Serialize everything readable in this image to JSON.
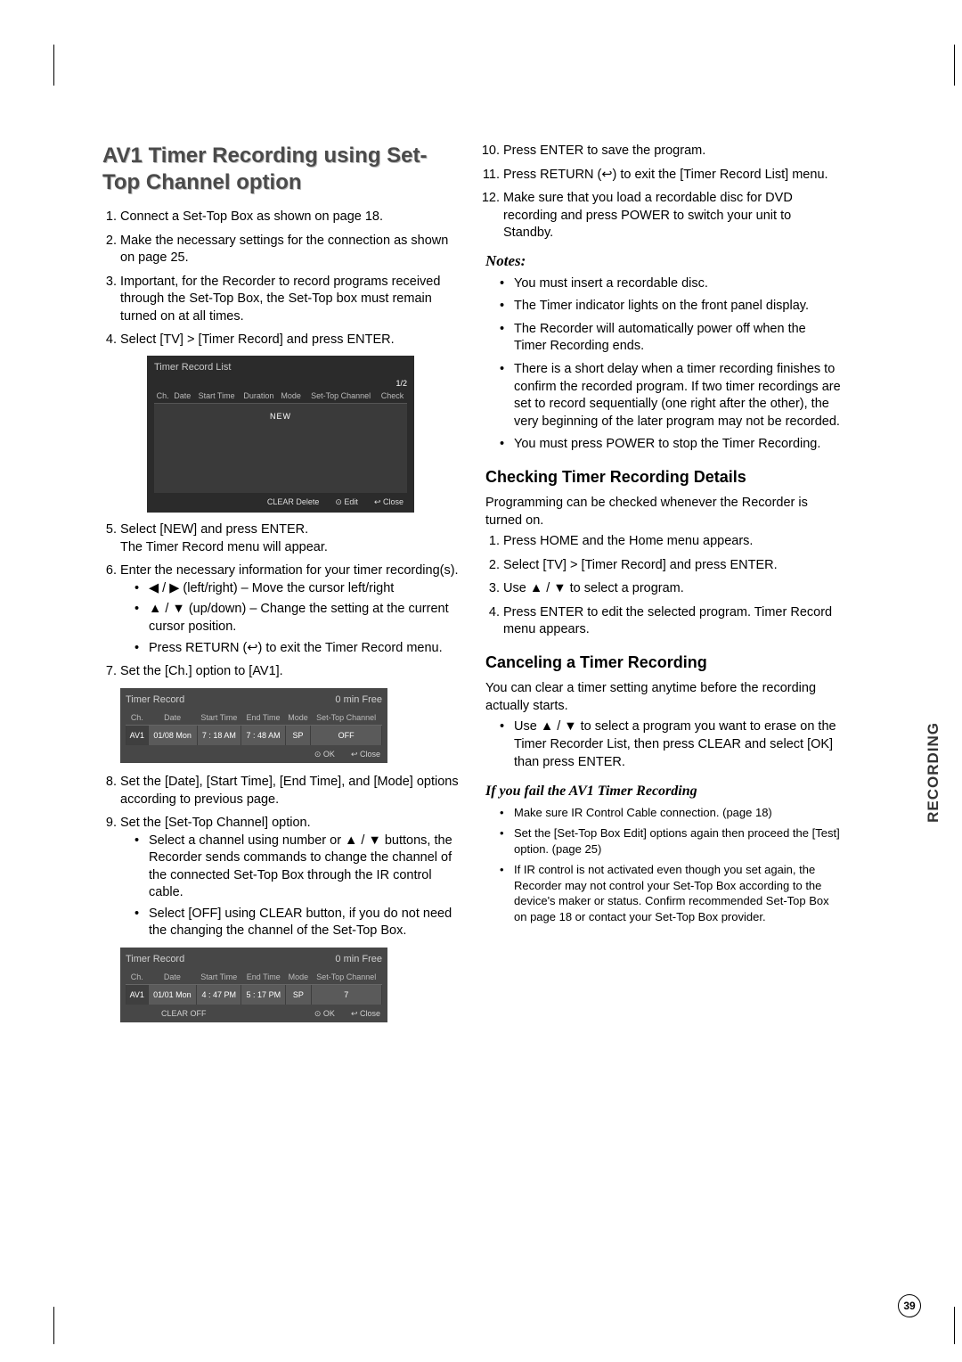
{
  "title": "AV1 Timer Recording using Set-Top Channel option",
  "sideLabel": "RECORDING",
  "pageNumber": "39",
  "left": {
    "steps": [
      "Connect a Set-Top Box as shown on page 18.",
      "Make the necessary settings for the connection as shown on page 25.",
      "Important, for the Recorder to record programs received through the Set-Top Box, the Set-Top box must remain turned on at all times.",
      "Select [TV] > [Timer Record] and press ENTER."
    ],
    "step5a": "Select [NEW] and press ENTER.",
    "step5b": "The Timer Record menu will appear.",
    "step6": "Enter the necessary information for your timer recording(s).",
    "step6bullets": [
      "◀ / ▶ (left/right) – Move the cursor left/right",
      "▲ / ▼ (up/down) – Change the setting at the current cursor position.",
      "Press RETURN (↩) to exit the Timer Record menu."
    ],
    "step7": "Set the [Ch.] option to [AV1].",
    "step8": "Set the [Date], [Start Time], [End Time], and [Mode] options according to previous page.",
    "step9": "Set the [Set-Top Channel] option.",
    "step9bullets": [
      "Select a channel using number or ▲ / ▼ buttons, the Recorder sends commands to change the channel of the connected Set-Top Box through the IR control cable.",
      "Select [OFF] using CLEAR button, if you do not need the changing the channel of the Set-Top Box."
    ]
  },
  "right": {
    "steps10_12": [
      "Press ENTER to save the program.",
      "Press RETURN (↩) to exit the [Timer Record List] menu.",
      "Make sure that you load a recordable disc for DVD recording and press POWER to switch your unit to Standby."
    ],
    "notesTitle": "Notes:",
    "notes": [
      "You must insert a recordable disc.",
      "The Timer indicator lights on the front panel display.",
      "The Recorder will automatically power off when the Timer Recording ends.",
      "There is a short delay when a timer recording finishes to confirm the recorded program. If two timer recordings are set to record sequentially (one right after the other), the very beginning of the later program may not be recorded.",
      "You must press POWER to stop the Timer Recording."
    ],
    "checkTitle": "Checking Timer Recording Details",
    "checkIntro": "Programming can be checked whenever the Recorder is turned on.",
    "checkSteps": [
      "Press HOME and the Home menu appears.",
      "Select [TV] > [Timer Record] and press ENTER.",
      "Use ▲ / ▼ to select a program.",
      "Press ENTER to edit the selected program. Timer Record menu appears."
    ],
    "cancelTitle": "Canceling a Timer Recording",
    "cancelIntro": "You can clear a timer setting anytime before the recording actually starts.",
    "cancelBullet": "Use ▲ / ▼ to select a program you want to erase on the Timer Recorder List, then press CLEAR and select [OK] than press ENTER.",
    "failTitle": "If you fail the AV1 Timer Recording",
    "failBullets": [
      "Make sure IR Control Cable connection. (page 18)",
      "Set the [Set-Top Box Edit] options again then proceed the [Test] option. (page 25)",
      "If IR control is not activated even though you set again, the Recorder may not control your Set-Top Box according to the device's maker or status. Confirm recommended Set-Top Box on page 18 or contact your Set-Top Box provider."
    ]
  },
  "osd1": {
    "title": "Timer Record List",
    "page": "1/2",
    "cols": [
      "Ch.",
      "Date",
      "Start Time",
      "Duration",
      "Mode",
      "Set-Top Channel",
      "Check"
    ],
    "newLabel": "NEW",
    "footer": {
      "delete": "CLEAR Delete",
      "edit": "⊙ Edit",
      "close": "↩ Close"
    }
  },
  "osd2": {
    "title": "Timer Record",
    "free": "0   min Free",
    "cols": [
      "Ch.",
      "Date",
      "Start Time",
      "End Time",
      "Mode",
      "Set-Top Channel"
    ],
    "row": [
      "AV1",
      "01/08 Mon",
      "7 : 18 AM",
      "7 : 48 AM",
      "SP",
      "OFF"
    ],
    "footer": {
      "ok": "⊙ OK",
      "close": "↩ Close"
    }
  },
  "osd3": {
    "title": "Timer Record",
    "free": "0   min Free",
    "cols": [
      "Ch.",
      "Date",
      "Start Time",
      "End Time",
      "Mode",
      "Set-Top Channel"
    ],
    "row": [
      "AV1",
      "01/01 Mon",
      "4 : 47 PM",
      "5 : 17 PM",
      "SP",
      "7"
    ],
    "footer": {
      "off": "CLEAR OFF",
      "ok": "⊙ OK",
      "close": "↩ Close"
    }
  }
}
